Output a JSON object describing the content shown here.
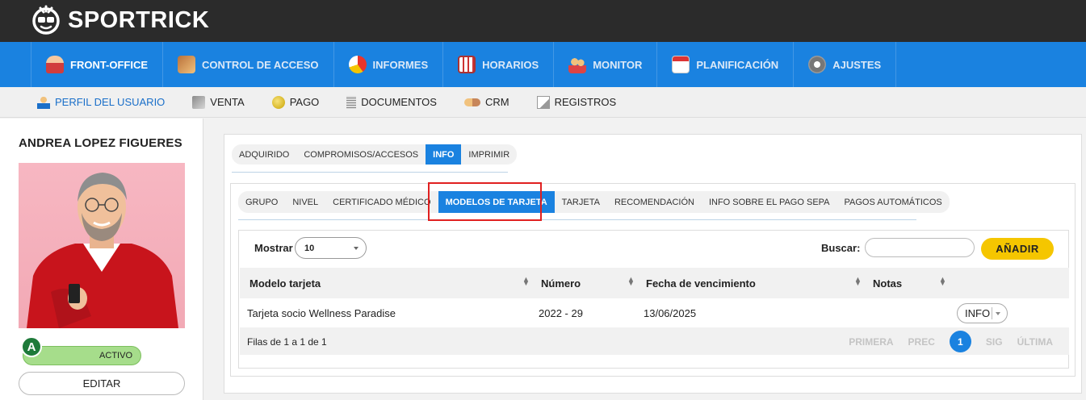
{
  "app": {
    "brand": "SPORTRICK"
  },
  "main_nav": [
    {
      "label": "FRONT-OFFICE",
      "icon": "user-icon"
    },
    {
      "label": "CONTROL DE ACCESO",
      "icon": "access-icon"
    },
    {
      "label": "INFORMES",
      "icon": "pie-chart-icon"
    },
    {
      "label": "HORARIOS",
      "icon": "schedule-icon"
    },
    {
      "label": "MONITOR",
      "icon": "monitor-icon"
    },
    {
      "label": "PLANIFICACIÓN",
      "icon": "calendar-icon"
    },
    {
      "label": "AJUSTES",
      "icon": "gear-icon"
    }
  ],
  "sub_nav": [
    {
      "label": "PERFIL DEL USUARIO",
      "icon": "user-icon"
    },
    {
      "label": "VENTA",
      "icon": "cash-icon"
    },
    {
      "label": "PAGO",
      "icon": "coins-icon"
    },
    {
      "label": "DOCUMENTOS",
      "icon": "document-icon"
    },
    {
      "label": "CRM",
      "icon": "handshake-icon"
    },
    {
      "label": "REGISTROS",
      "icon": "log-icon"
    }
  ],
  "user": {
    "name": "ANDREA LOPEZ FIGUERES",
    "status": "ACTIVO",
    "badge": "A",
    "edit_label": "EDITAR"
  },
  "tabs_level1": [
    "ADQUIRIDO",
    "COMPROMISOS/ACCESOS",
    "INFO",
    "IMPRIMIR"
  ],
  "tabs_level2": [
    "GRUPO",
    "NIVEL",
    "CERTIFICADO MÉDICO",
    "MODELOS DE TARJETA",
    "TARJETA",
    "RECOMENDACIÓN",
    "INFO SOBRE EL PAGO SEPA",
    "PAGOS AUTOMÁTICOS"
  ],
  "table": {
    "show_label": "Mostrar",
    "show_value": "10",
    "search_label": "Buscar:",
    "add_label": "AÑADIR",
    "columns": [
      "Modelo tarjeta",
      "Número",
      "Fecha de vencimiento",
      "Notas"
    ],
    "rows": [
      {
        "modelo": "Tarjeta socio Wellness Paradise",
        "numero": "2022 - 29",
        "fecha": "13/06/2025",
        "notas": "",
        "action": "INFO"
      }
    ],
    "footer": "Filas de 1 a 1 de 1",
    "pager": {
      "first": "PRIMERA",
      "prev": "PREC",
      "current": "1",
      "next": "SIG",
      "last": "ÚLTIMA"
    }
  },
  "colors": {
    "accent": "#1a82e0",
    "active_status": "#a6dd8b",
    "add_button": "#f5c600",
    "highlight": "#e02020"
  }
}
